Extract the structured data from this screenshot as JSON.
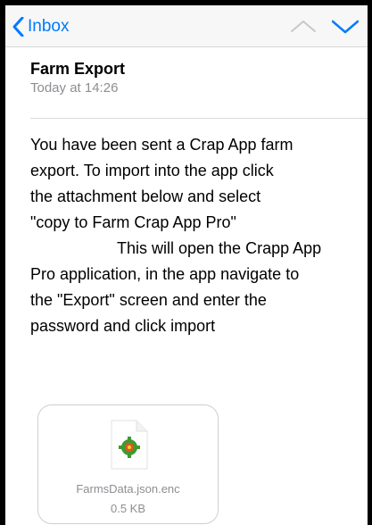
{
  "nav": {
    "back_label": "Inbox",
    "back_icon": "chevron-left-icon",
    "prev_icon": "chevron-up-icon",
    "next_icon": "chevron-down-icon",
    "accent_color": "#007aff"
  },
  "message": {
    "subject": "Farm Export",
    "date": "Today at 14:26",
    "body_lines": [
      "You have been sent a Crap App farm",
      "export. To import into the app click",
      "the attachment below and select",
      "\"copy to Farm Crap App Pro\"",
      "This will open the Crapp App",
      "Pro application, in the app navigate to",
      "the \"Export\" screen and enter the",
      "password and click import"
    ]
  },
  "attachment": {
    "filename": "FarmsData.json.enc",
    "size": "0.5 KB",
    "icon": "document-icon"
  }
}
